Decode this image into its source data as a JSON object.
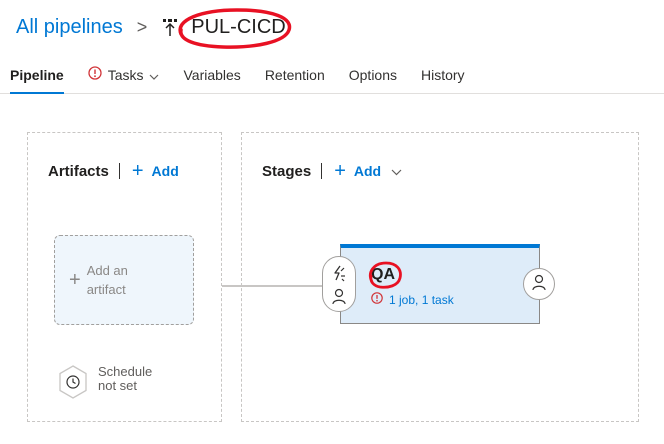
{
  "breadcrumb": {
    "parent": "All pipelines",
    "separator": ">",
    "pipeline_name": "PUL-CICD"
  },
  "tabs": [
    {
      "label": "Pipeline",
      "active": true
    },
    {
      "label": "Tasks",
      "warning": true,
      "dropdown": true
    },
    {
      "label": "Variables"
    },
    {
      "label": "Retention"
    },
    {
      "label": "Options"
    },
    {
      "label": "History"
    }
  ],
  "artifacts": {
    "title": "Artifacts",
    "add_label": "Add",
    "add_artifact_line1": "Add an",
    "add_artifact_line2": "artifact",
    "schedule_line1": "Schedule",
    "schedule_line2": "not set"
  },
  "stages": {
    "title": "Stages",
    "add_label": "Add",
    "items": [
      {
        "name": "QA",
        "status": "1 job, 1 task"
      }
    ]
  },
  "colors": {
    "accent": "#0078d4",
    "annotation_red": "#e81123",
    "stage_bg": "#deecf9",
    "artifact_bg": "#eff6fc"
  },
  "icons": [
    "pipeline-icon",
    "warning-icon",
    "chevron-down-icon",
    "plus-icon",
    "clock-icon",
    "lightning-icon",
    "person-icon",
    "error-icon"
  ]
}
